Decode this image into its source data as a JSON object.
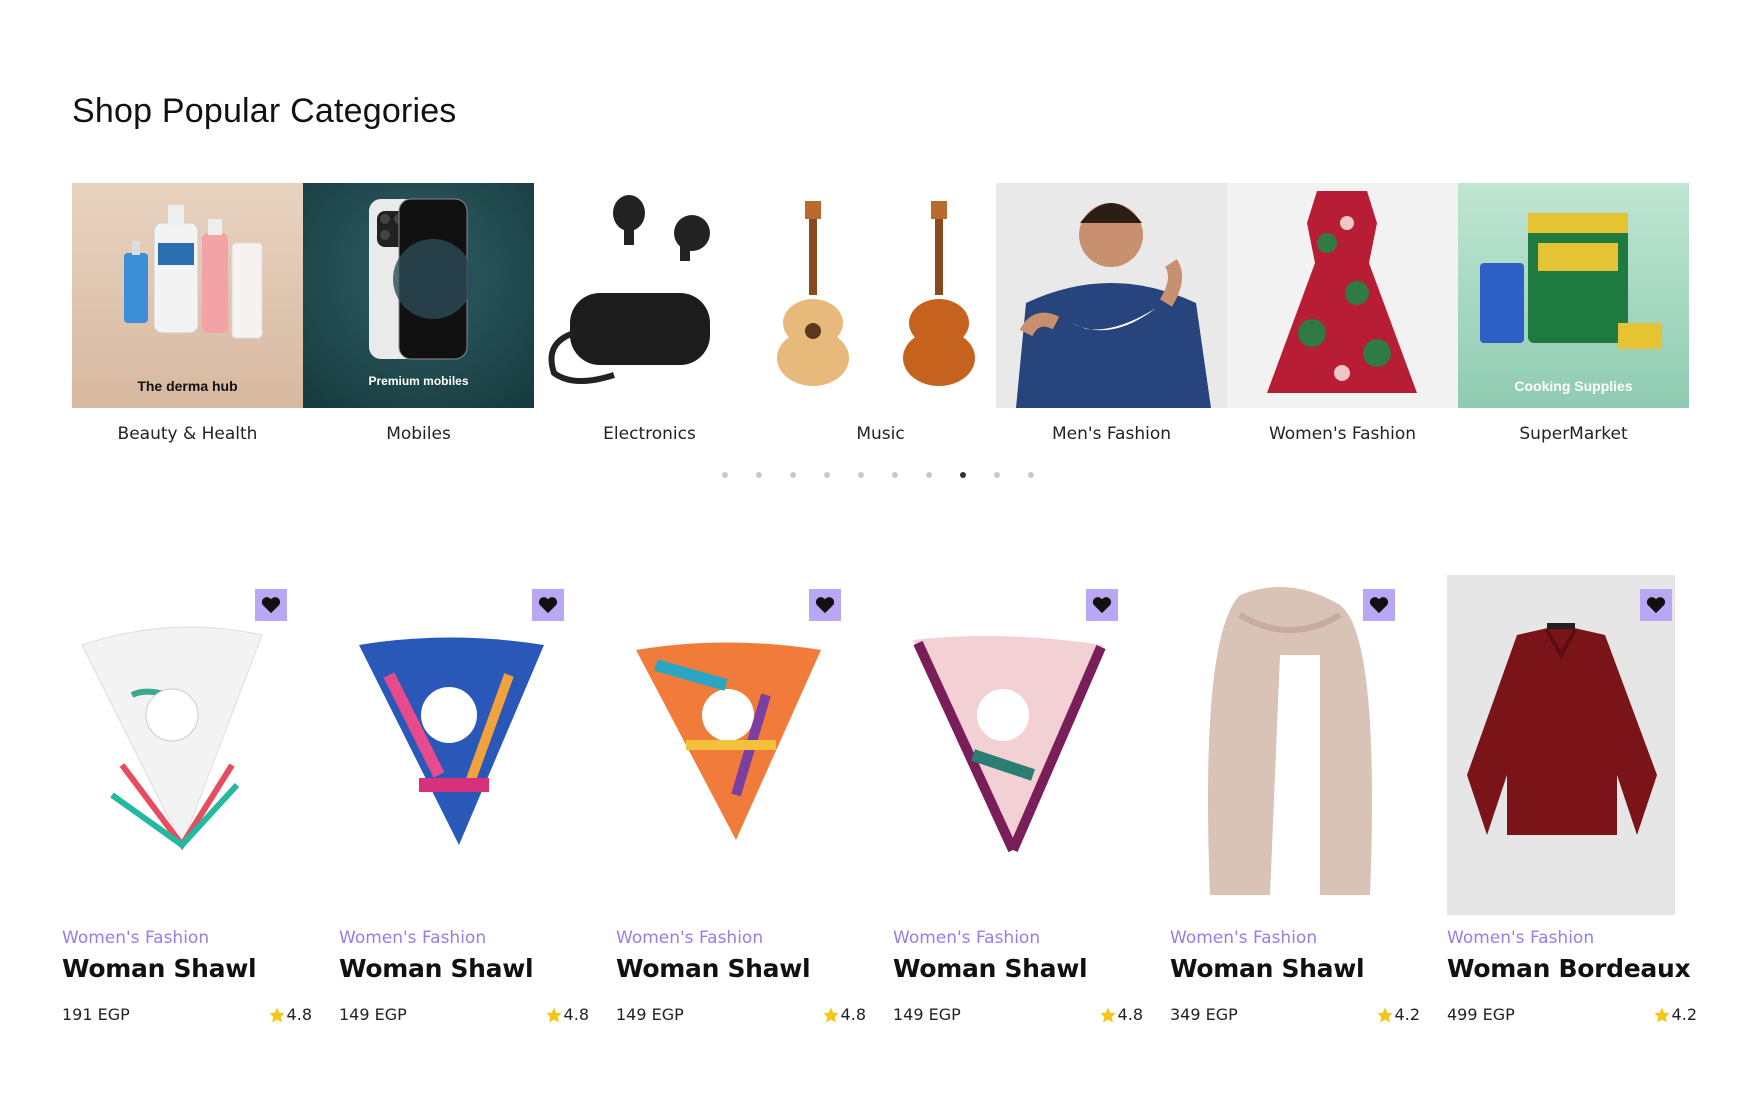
{
  "section_title": "Shop Popular Categories",
  "categories": [
    {
      "label": "Beauty & Health",
      "caption": "The derma hub"
    },
    {
      "label": "Mobiles",
      "caption": "Premium mobiles"
    },
    {
      "label": "Electronics",
      "caption": ""
    },
    {
      "label": "Music",
      "caption": ""
    },
    {
      "label": "Men's Fashion",
      "caption": ""
    },
    {
      "label": "Women's Fashion",
      "caption": ""
    },
    {
      "label": "SuperMarket",
      "caption": "Cooking Supplies"
    }
  ],
  "carousel": {
    "dot_count": 10,
    "active_index": 7
  },
  "products": [
    {
      "category": "Women's Fashion",
      "name": "Woman Shawl",
      "price": "191 EGP",
      "rating": "4.8"
    },
    {
      "category": "Women's Fashion",
      "name": "Woman Shawl",
      "price": "149 EGP",
      "rating": "4.8"
    },
    {
      "category": "Women's Fashion",
      "name": "Woman Shawl",
      "price": "149 EGP",
      "rating": "4.8"
    },
    {
      "category": "Women's Fashion",
      "name": "Woman Shawl",
      "price": "149 EGP",
      "rating": "4.8"
    },
    {
      "category": "Women's Fashion",
      "name": "Woman Shawl",
      "price": "349 EGP",
      "rating": "4.2"
    },
    {
      "category": "Women's Fashion",
      "name": "Woman Bordeaux",
      "price": "499 EGP",
      "rating": "4.2"
    }
  ],
  "colors": {
    "accent": "#9b7be6",
    "heart_bg": "#b9a7f4",
    "star": "#f5c518"
  }
}
